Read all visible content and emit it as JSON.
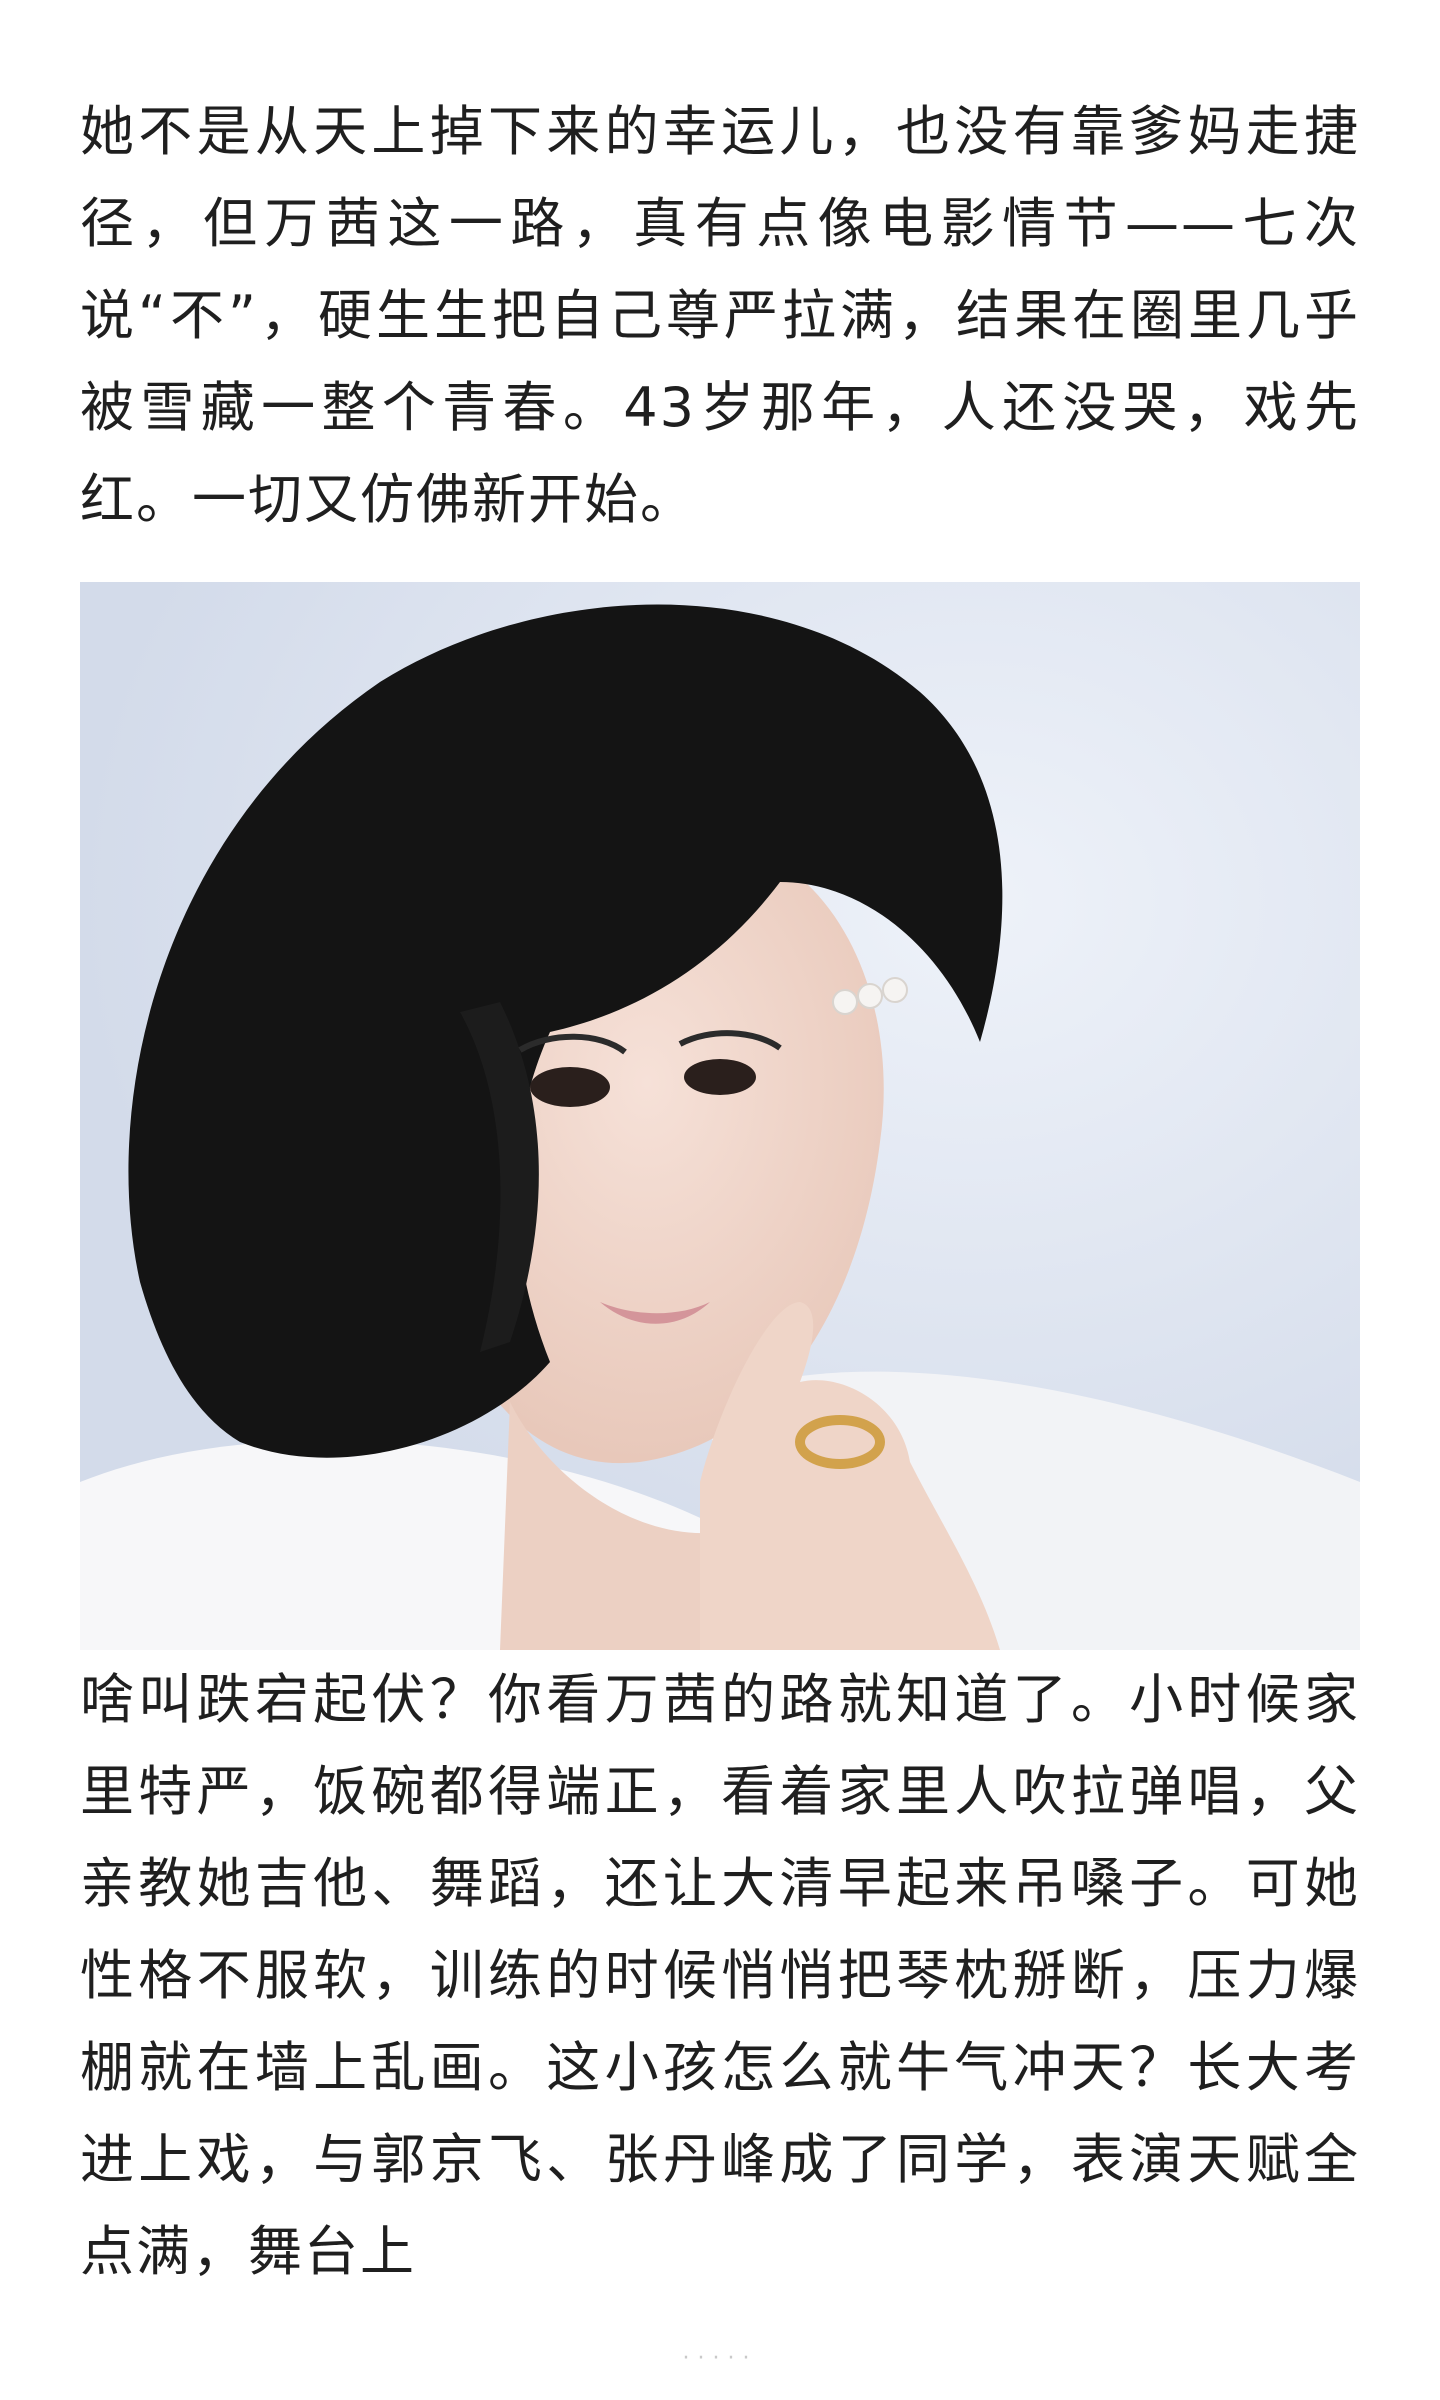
{
  "article": {
    "paragraph_1": "她不是从天上掉下来的幸运儿，也没有靠爹妈走捷径，但万茜这一路，真有点像电影情节——七次说“不”，硬生生把自己尊严拉满，结果在圈里几乎被雪藏一整个青春。43岁那年，人还没哭，戏先红。一切又仿佛新开始。",
    "paragraph_2": "啥叫跌宕起伏？你看万茜的路就知道了。小时候家里特严，饭碗都得端正，看着家里人吹拉弹唱，父亲教她吉他、舞蹈，还让大清早起来吊嗓子。可她性格不服软，训练的时候悄悄把琴枕掰断，压力爆棚就在墙上乱画。这小孩怎么就牛气冲天？长大考进上戏，与郭京飞、张丹峰成了同学，表演天赋全点满，舞台上"
  },
  "footer": {
    "dots": "·····"
  },
  "colors": {
    "text": "#1f1f1f",
    "photo_background": "#dde3ee",
    "hair": "#141414"
  }
}
